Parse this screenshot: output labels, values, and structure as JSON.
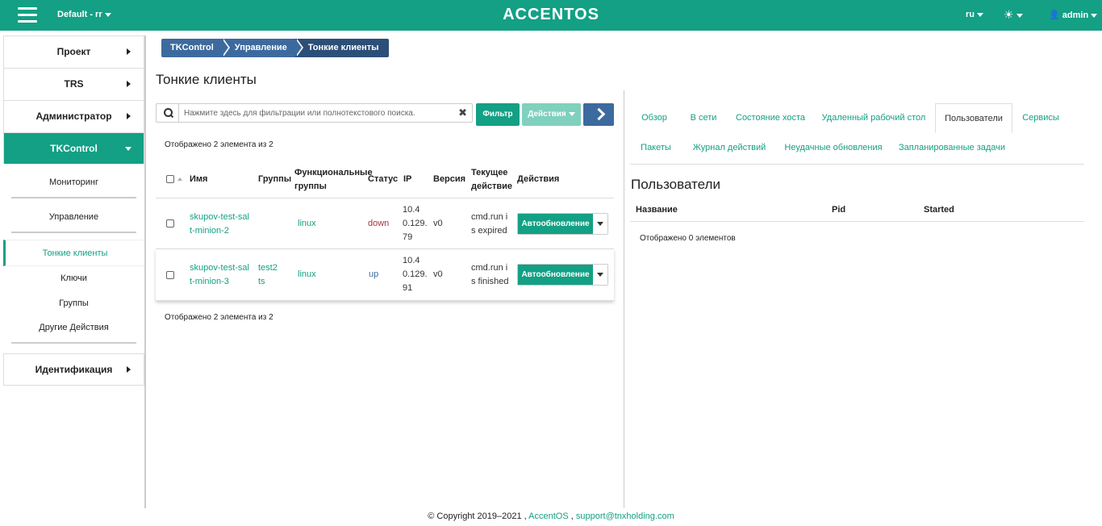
{
  "topbar": {
    "project": "Default - rr",
    "logo": "ACCENTOS",
    "lang": "ru",
    "user": "admin"
  },
  "sidebar": {
    "sections": [
      "Проект",
      "TRS",
      "Администратор",
      "TKControl"
    ],
    "sub": {
      "monitoring": "Мониторинг",
      "management": "Управление",
      "thin_clients": "Тонкие клиенты",
      "keys": "Ключи",
      "groups": "Группы",
      "other_actions": "Другие Действия"
    },
    "identity": "Идентификация"
  },
  "breadcrumb": [
    "TKControl",
    "Управление",
    "Тонкие клиенты"
  ],
  "page_title": "Тонкие клиенты",
  "search": {
    "placeholder": "Нажмите здесь для фильтрации или полнотекстового поиска.",
    "clear": "✖"
  },
  "buttons": {
    "filter": "Фильтр",
    "actions": "Действия"
  },
  "count_text": "Отображено 2 элемента из 2",
  "table": {
    "headers": {
      "name": "Имя",
      "groups": "Группы",
      "func_groups_1": "Функциональные",
      "func_groups_2": "группы",
      "status": "Статус",
      "ip": "IP",
      "version": "Версия",
      "current_1": "Текущее",
      "current_2": "действие",
      "actions": "Действия"
    },
    "rows": [
      {
        "name_1": "skupov-test-sal",
        "name_2": "t-minion-2",
        "groups_1": "",
        "groups_2": "",
        "func": "linux",
        "status": "down",
        "ip_1": "10.4",
        "ip_2": "0.129.",
        "ip_3": "79",
        "version": "v0",
        "action_1": "cmd.run i",
        "action_2": "s expired",
        "button": "Автообновление"
      },
      {
        "name_1": "skupov-test-sal",
        "name_2": "t-minion-3",
        "groups_1": "test2",
        "groups_2": "ts",
        "func": "linux",
        "status": "up",
        "ip_1": "10.4",
        "ip_2": "0.129.",
        "ip_3": "91",
        "version": "v0",
        "action_1": "cmd.run i",
        "action_2": "s finished",
        "button": "Автообновление"
      }
    ]
  },
  "tabs": {
    "overview": "Обзор",
    "online": "В сети",
    "host_state": "Состояние хоста",
    "remote_desktop": "Удаленный рабочий стол",
    "users": "Пользователи",
    "services": "Сервисы",
    "packages": "Пакеты",
    "action_log": "Журнал действий",
    "failed_updates": "Неудачные обновления",
    "scheduled_tasks": "Запланированные задачи"
  },
  "users_pane": {
    "title": "Пользователи",
    "col_name": "Название",
    "col_pid": "Pid",
    "col_started": "Started",
    "count_text": "Отображено 0 элементов"
  },
  "footer": {
    "copyright": "© Copyright 2019–2021 ,",
    "accentos": "AccentOS",
    "sep": ",",
    "email": "support@tnxholding.com"
  }
}
